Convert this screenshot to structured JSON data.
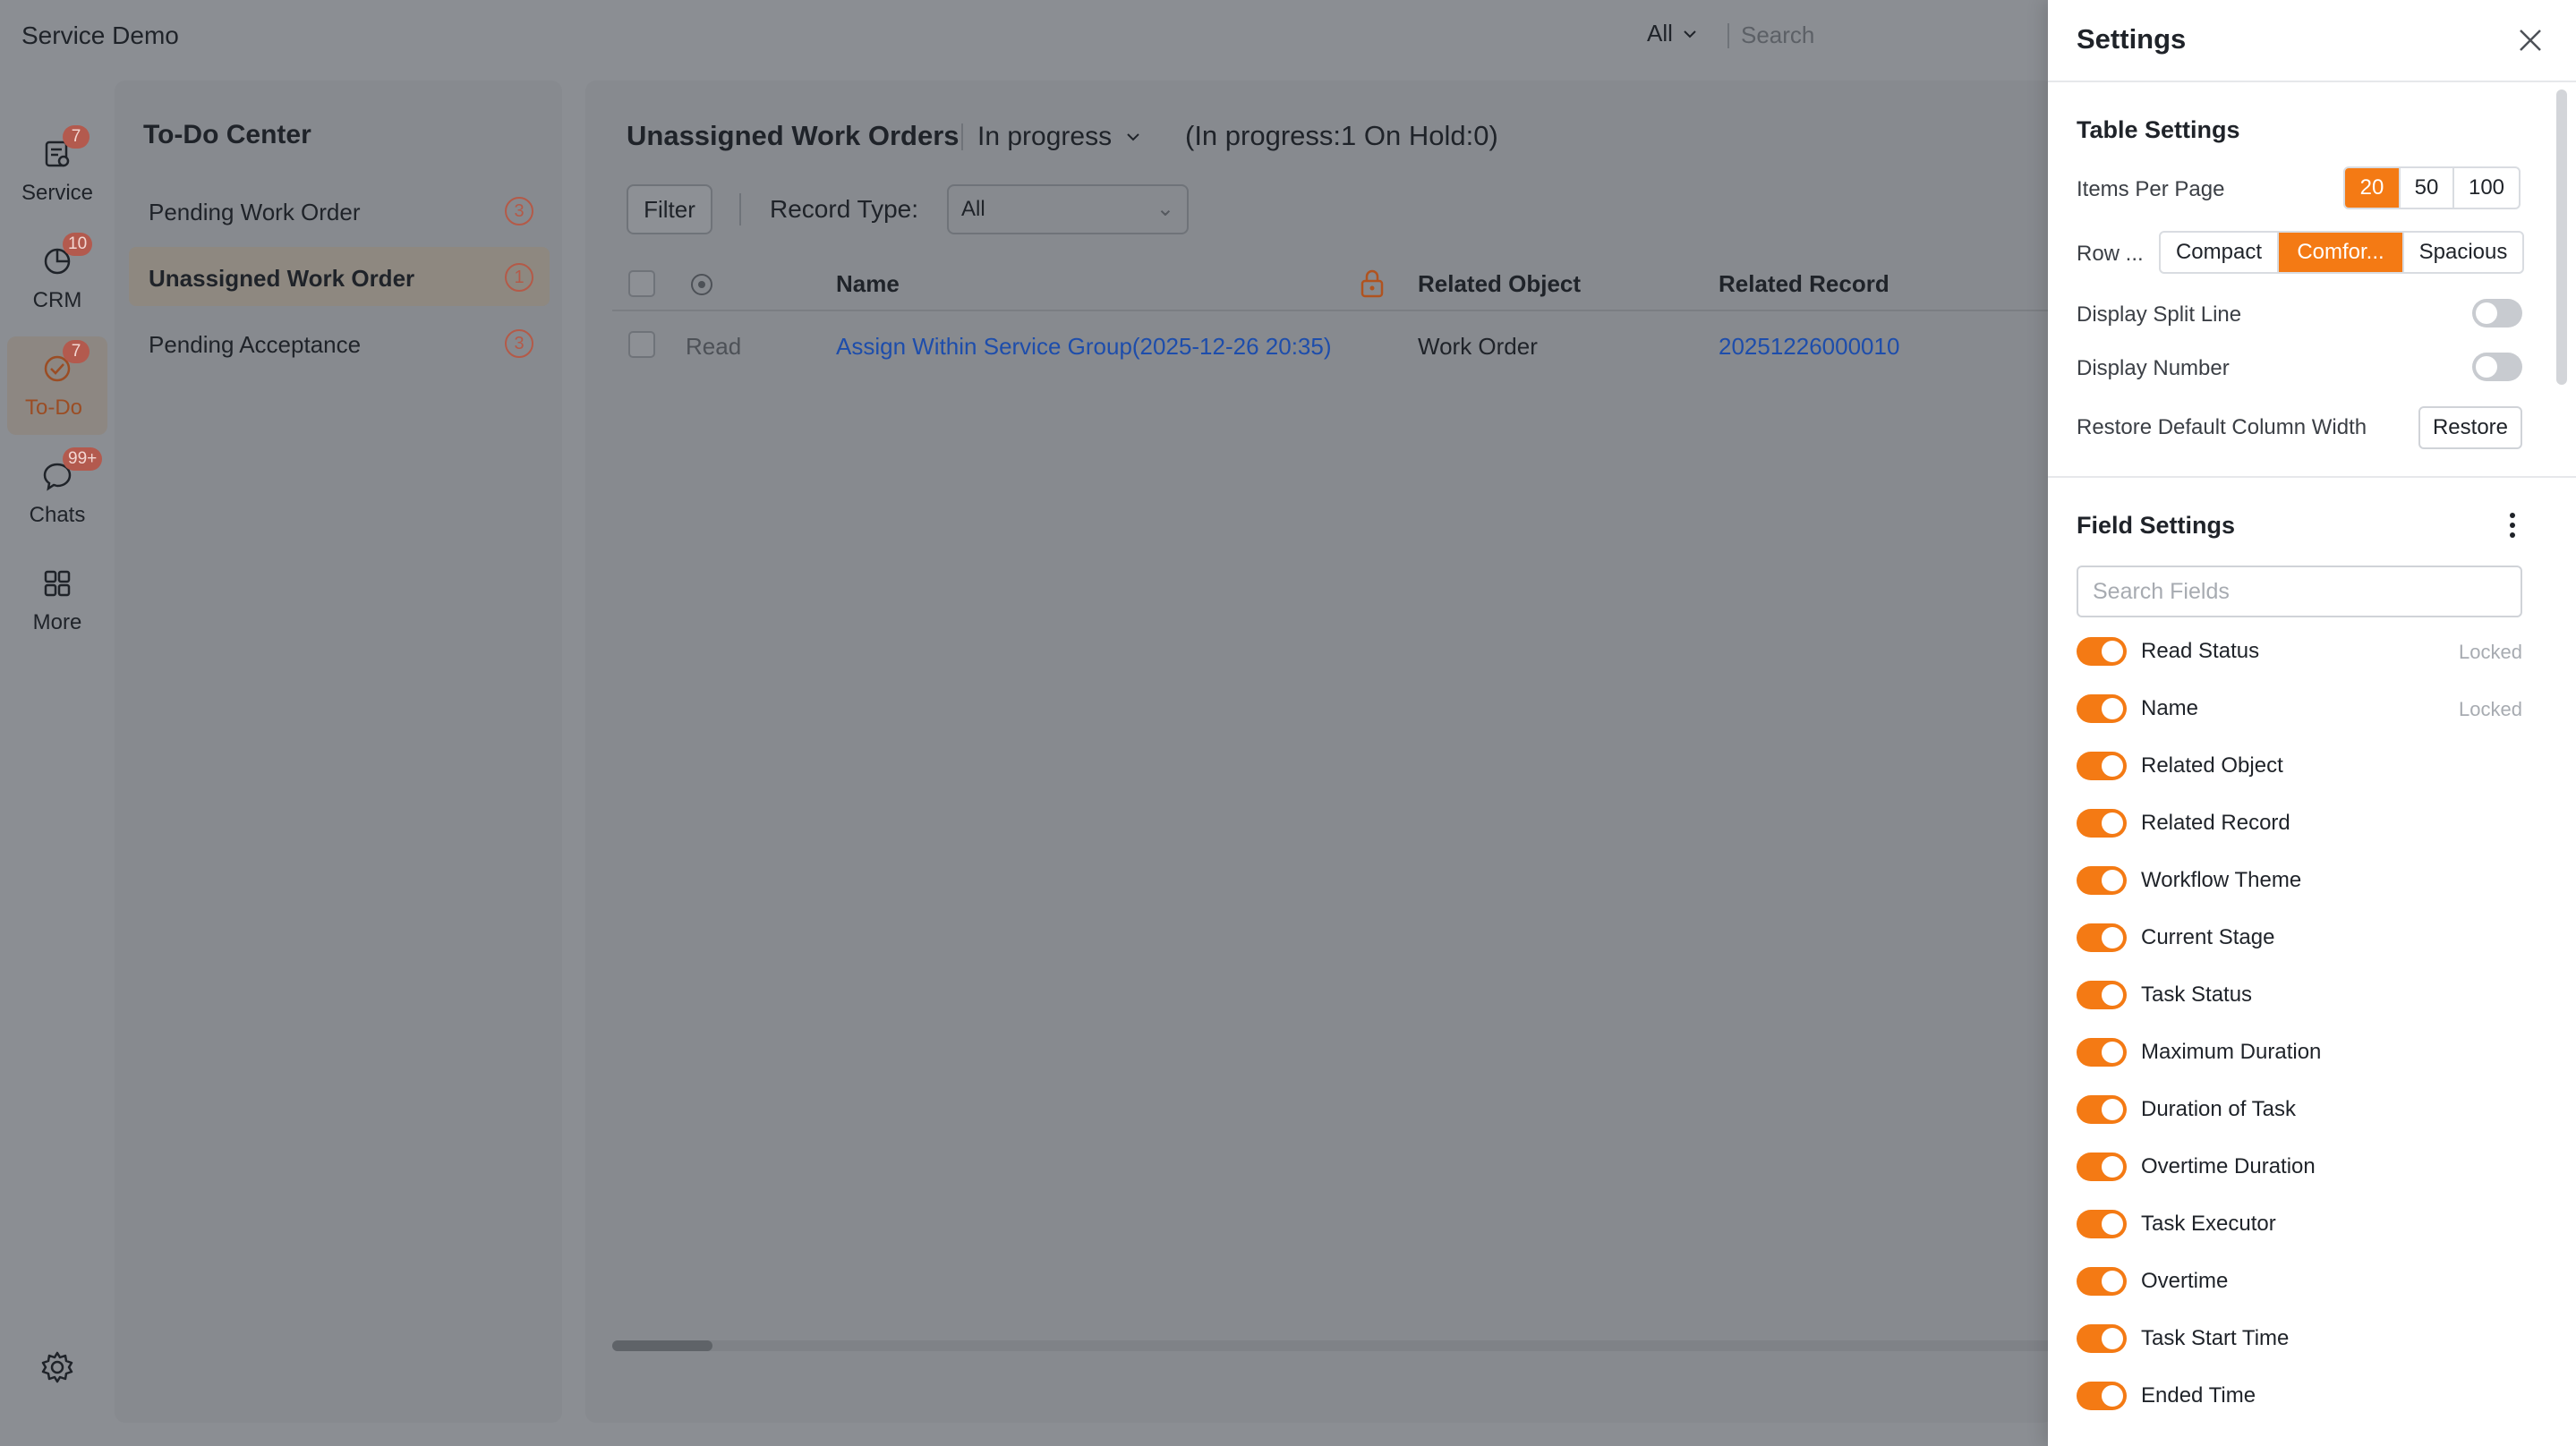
{
  "app": {
    "title": "Service Demo"
  },
  "topbar": {
    "scope": "All",
    "search_placeholder": "Search"
  },
  "leftnav": {
    "items": [
      {
        "label": "Service",
        "badge": "7",
        "icon": "service-icon"
      },
      {
        "label": "CRM",
        "badge": "10",
        "icon": "crm-icon"
      },
      {
        "label": "To-Do",
        "badge": "7",
        "icon": "todo-icon",
        "active": true
      },
      {
        "label": "Chats",
        "badge": "99+",
        "icon": "chat-icon"
      },
      {
        "label": "More",
        "badge": "",
        "icon": "grid-icon"
      }
    ]
  },
  "todo": {
    "title": "To-Do Center",
    "items": [
      {
        "label": "Pending Work Order",
        "count": "3"
      },
      {
        "label": "Unassigned Work Order",
        "count": "1",
        "active": true
      },
      {
        "label": "Pending Acceptance",
        "count": "3"
      }
    ]
  },
  "main": {
    "title": "Unassigned Work Orders",
    "status": "In progress",
    "counts": "(In progress:1 On Hold:0)",
    "filter_label": "Filter",
    "record_type_label": "Record Type:",
    "record_type_value": "All",
    "columns": {
      "name": "Name",
      "related_object": "Related Object",
      "related_record": "Related Record"
    },
    "rows": [
      {
        "read": "Read",
        "name": "Assign Within Service Group(2025-12-26 20:35)",
        "related_object": "Work Order",
        "related_record": "20251226000010"
      }
    ]
  },
  "settings": {
    "title": "Settings",
    "table_settings": {
      "title": "Table Settings",
      "items_per_page_label": "Items Per Page",
      "items_per_page_options": [
        "20",
        "50",
        "100"
      ],
      "items_per_page_selected": "20",
      "row_label": "Row ...",
      "row_options": [
        "Compact",
        "Comfor...",
        "Spacious"
      ],
      "row_selected": "Comfor...",
      "split_line_label": "Display Split Line",
      "split_line_on": false,
      "number_label": "Display Number",
      "number_on": false,
      "restore_label": "Restore Default Column Width",
      "restore_button": "Restore"
    },
    "field_settings": {
      "title": "Field Settings",
      "search_placeholder": "Search Fields",
      "locked_label": "Locked",
      "fields": [
        {
          "name": "Read Status",
          "locked": true
        },
        {
          "name": "Name",
          "locked": true
        },
        {
          "name": "Related Object",
          "locked": false
        },
        {
          "name": "Related Record",
          "locked": false
        },
        {
          "name": "Workflow Theme",
          "locked": false
        },
        {
          "name": "Current Stage",
          "locked": false
        },
        {
          "name": "Task Status",
          "locked": false
        },
        {
          "name": "Maximum Duration",
          "locked": false
        },
        {
          "name": "Duration of Task",
          "locked": false
        },
        {
          "name": "Overtime Duration",
          "locked": false
        },
        {
          "name": "Task Executor",
          "locked": false
        },
        {
          "name": "Overtime",
          "locked": false
        },
        {
          "name": "Task Start Time",
          "locked": false
        },
        {
          "name": "Ended Time",
          "locked": false
        }
      ]
    }
  },
  "colors": {
    "accent": "#f47a14",
    "link": "#1d4dab",
    "badge": "#e2574c"
  }
}
